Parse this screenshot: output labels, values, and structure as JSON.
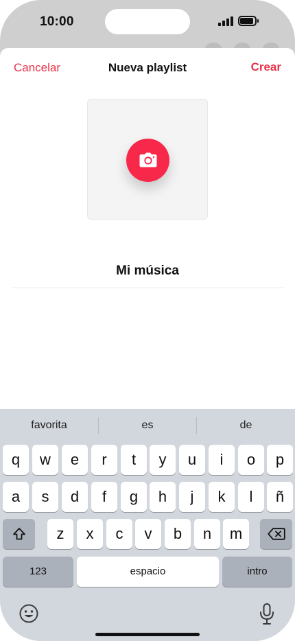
{
  "status": {
    "time": "10:00"
  },
  "sheet": {
    "cancel_label": "Cancelar",
    "title": "Nueva playlist",
    "create_label": "Crear",
    "playlist_name": "Mi música"
  },
  "keyboard": {
    "suggestions": [
      "favorita",
      "es",
      "de"
    ],
    "row1": [
      "q",
      "w",
      "e",
      "r",
      "t",
      "y",
      "u",
      "i",
      "o",
      "p"
    ],
    "row2": [
      "a",
      "s",
      "d",
      "f",
      "g",
      "h",
      "j",
      "k",
      "l",
      "ñ"
    ],
    "row3": [
      "z",
      "x",
      "c",
      "v",
      "b",
      "n",
      "m"
    ],
    "numbers_label": "123",
    "space_label": "espacio",
    "return_label": "intro"
  },
  "colors": {
    "accent": "#e8334b",
    "camera_button": "#f7284a"
  },
  "icons": [
    "camera-icon",
    "shift-icon",
    "delete-icon",
    "emoji-icon",
    "microphone-icon"
  ]
}
